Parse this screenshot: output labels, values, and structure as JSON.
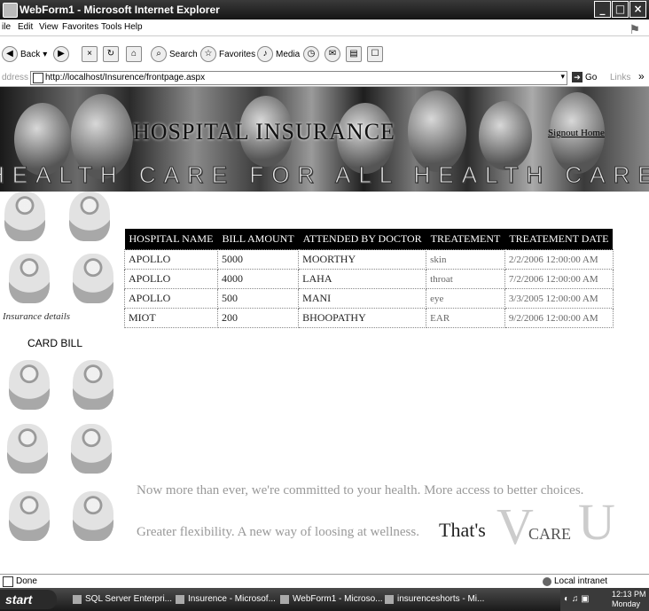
{
  "window": {
    "title": "WebForm1 - Microsoft Internet Explorer"
  },
  "menu": [
    "ile",
    "Edit",
    "View",
    "Favorites",
    "Tools",
    "Help"
  ],
  "toolbar": {
    "back": "Back",
    "search": "Search",
    "favorites": "Favorites",
    "media": "Media"
  },
  "address": {
    "label": "ddress",
    "url": "http://localhost/Insurence/frontpage.aspx",
    "go": "Go",
    "links": "Links"
  },
  "banner": {
    "title": "HOSPITAL INSURANCE",
    "signout": "Signout Home",
    "marquee": "HEALTH CARE FOR ALL   HEALTH CARE FOR ALL   HE"
  },
  "sidebar": {
    "link": "Insurance details",
    "card_bill": "CARD BILL"
  },
  "table": {
    "headers": [
      "HOSPITAL NAME",
      "BILL AMOUNT",
      "ATTENDED BY DOCTOR",
      "TREATEMENT",
      "TREATEMENT DATE"
    ],
    "rows": [
      [
        "APOLLO",
        "5000",
        "MOORTHY",
        "skin",
        "2/2/2006 12:00:00 AM"
      ],
      [
        "APOLLO",
        "4000",
        "LAHA",
        "throat",
        "7/2/2006 12:00:00 AM"
      ],
      [
        "APOLLO",
        "500",
        "MANI",
        "eye",
        "3/3/2005 12:00:00 AM"
      ],
      [
        "MIOT",
        "200",
        "BHOOPATHY",
        "EAR",
        "9/2/2006 12:00:00 AM"
      ]
    ]
  },
  "tagline": {
    "line1": "Now more than ever, we're committed to your health. More access to better choices.",
    "line2": "Greater flexibility. A new way of loosing at wellness.",
    "thats": "That's",
    "v": "V",
    "care": "CARE",
    "u": "U"
  },
  "status": {
    "text": "Done",
    "zone": "Local intranet"
  },
  "taskbar": {
    "start": "start",
    "tasks": [
      "SQL Server Enterpri...",
      "Insurence - Microsof...",
      "WebForm1 - Microso...",
      "insurenceshorts - Mi..."
    ],
    "time": "12:13 PM",
    "day": "Monday"
  }
}
